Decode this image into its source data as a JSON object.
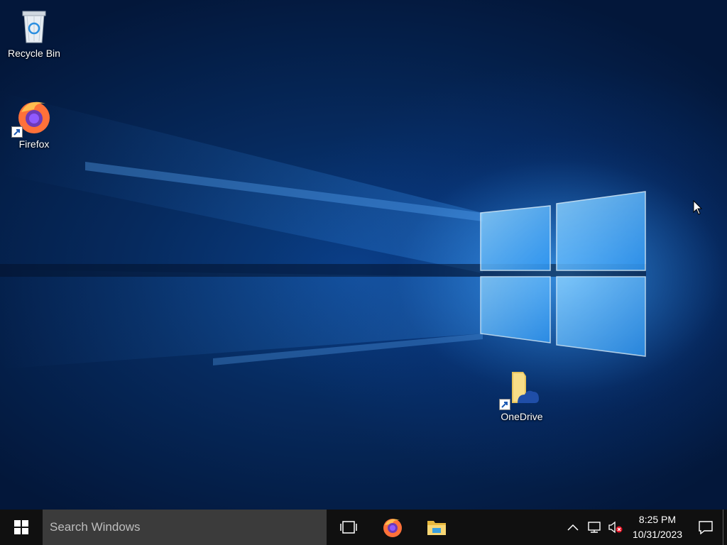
{
  "desktop": {
    "icons": [
      {
        "label": "Recycle Bin",
        "icon": "recycle-bin-icon"
      },
      {
        "label": "Firefox",
        "icon": "firefox-icon",
        "shortcut": true
      },
      {
        "label": "OneDrive",
        "icon": "onedrive-folder-icon",
        "shortcut": true
      }
    ]
  },
  "taskbar": {
    "start_icon": "windows-logo-icon",
    "search_placeholder": "Search Windows",
    "pinned": [
      {
        "name": "task-view",
        "icon": "task-view-icon"
      },
      {
        "name": "firefox",
        "icon": "firefox-icon"
      },
      {
        "name": "file-explorer",
        "icon": "folder-icon"
      }
    ],
    "tray": {
      "icons": [
        "chevron-up-icon",
        "network-icon",
        "volume-muted-icon"
      ],
      "time": "8:25 PM",
      "date": "10/31/2023",
      "notification_icon": "notification-icon"
    }
  },
  "colors": {
    "taskbar": "#101010",
    "search_box": "#3b3b3b",
    "accent": "#1e90ff"
  }
}
